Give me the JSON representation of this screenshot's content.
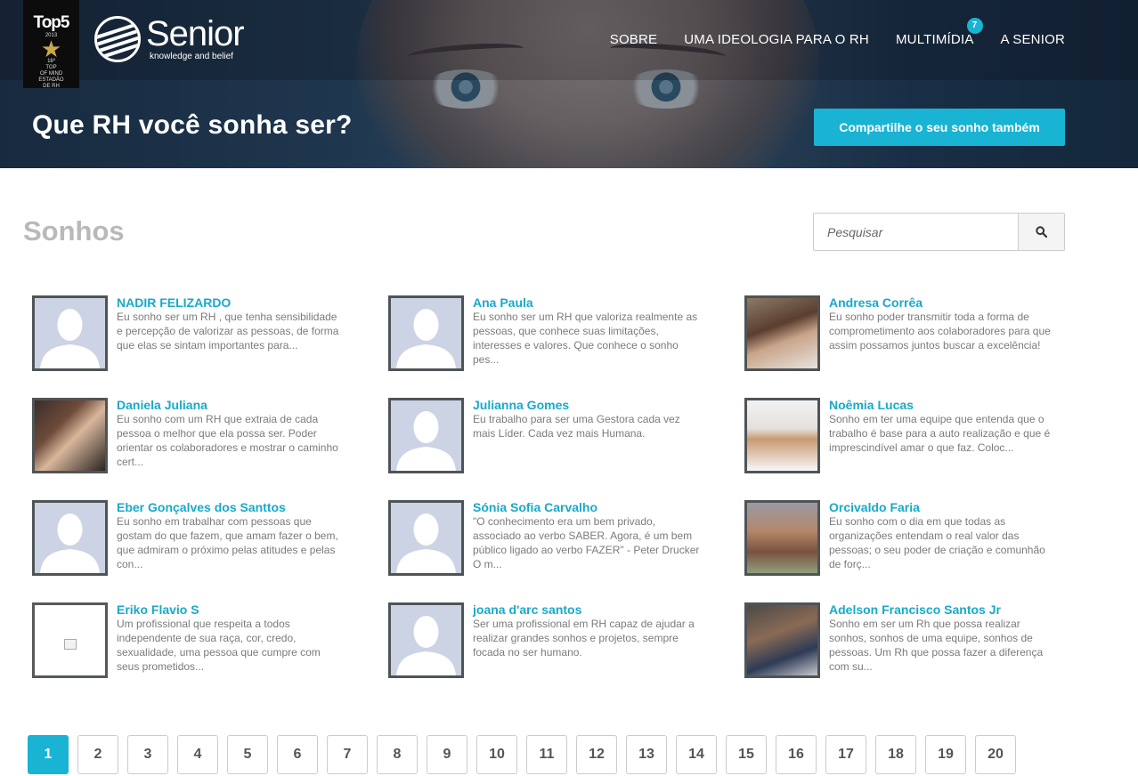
{
  "brand": {
    "award": {
      "title": "Top5",
      "year": "2013",
      "lines": [
        "16º",
        "TOP",
        "OF MIND",
        "ESTADÃO",
        "DE RH"
      ]
    },
    "name": "Senior",
    "tagline": "knowledge and belief"
  },
  "nav": {
    "items": [
      {
        "label": "SOBRE"
      },
      {
        "label": "UMA IDEOLOGIA PARA O RH"
      },
      {
        "label": "MULTIMÍDIA",
        "badge": "7"
      },
      {
        "label": "A SENIOR"
      }
    ]
  },
  "hero": {
    "title": "Que RH você sonha ser?",
    "cta": "Compartilhe o seu sonho também"
  },
  "section": {
    "title": "Sonhos",
    "search_placeholder": "Pesquisar"
  },
  "dreams": [
    {
      "name": "NADIR FELIZARDO",
      "text": "Eu sonho ser um RH , que tenha sensibilidade e percepção de valorizar as pessoas, de forma que elas se sintam importantes para...",
      "avatar": "placeholder"
    },
    {
      "name": "Ana Paula",
      "text": "Eu sonho ser um RH que valoriza realmente as pessoas, que conhece suas limitações, interesses e valores. Que conhece o sonho pes...",
      "avatar": "placeholder"
    },
    {
      "name": "Andresa Corrêa",
      "text": "Eu sonho poder transmitir toda a forma de comprometimento aos colaboradores para que assim possamos juntos buscar a excelência!",
      "avatar": "photo"
    },
    {
      "name": "Daniela Juliana",
      "text": "Eu sonho com um RH que extraia de cada pessoa o melhor que ela possa ser. Poder orientar os colaboradores e mostrar o caminho cert...",
      "avatar": "photo"
    },
    {
      "name": "Julianna Gomes",
      "text": "Eu trabalho para ser uma Gestora cada vez mais Líder. Cada vez mais Humana.",
      "avatar": "placeholder"
    },
    {
      "name": "Noêmia Lucas",
      "text": "Sonho em ter uma equipe que entenda que o trabalho é base para a auto realização e que é imprescindível amar o que faz. Coloc...",
      "avatar": "photo"
    },
    {
      "name": "Eber Gonçalves dos Santtos",
      "text": "Eu sonho em trabalhar com pessoas que gostam do que fazem, que amam fazer o bem, que admiram o próximo pelas atitudes e pelas con...",
      "avatar": "placeholder"
    },
    {
      "name": "Sónia Sofia Carvalho",
      "text": "\"O conhecimento era um bem privado, associado ao verbo SABER. Agora, é um bem público ligado ao verbo FAZER\" - Peter Drucker O m...",
      "avatar": "placeholder"
    },
    {
      "name": "Orcivaldo Faria",
      "text": "Eu sonho com o dia em que todas as organizações entendam o real valor das pessoas; o seu poder de criação e comunhão de forç...",
      "avatar": "photo"
    },
    {
      "name": "Eriko Flavio S",
      "text": "Um profissional que respeita a todos independente de sua raça, cor, credo, sexualidade, uma pessoa que cumpre com seus prometidos...",
      "avatar": "broken"
    },
    {
      "name": "joana d'arc santos",
      "text": "Ser uma profissional em RH capaz de ajudar a realizar grandes sonhos e projetos, sempre focada no ser humano.",
      "avatar": "placeholder"
    },
    {
      "name": "Adelson Francisco Santos Jr",
      "text": "Sonho em ser um Rh que possa realizar sonhos, sonhos de uma equipe, sonhos de pessoas. Um Rh que possa fazer a diferença com su...",
      "avatar": "photo"
    }
  ],
  "pagination": {
    "current": "1",
    "pages": [
      "1",
      "2",
      "3",
      "4",
      "5",
      "6",
      "7",
      "8",
      "9",
      "10",
      "11",
      "12",
      "13",
      "14",
      "15",
      "16",
      "17",
      "18",
      "19",
      "20"
    ]
  },
  "colors": {
    "accent": "#19b3d3",
    "name": "#19a9c9",
    "heading_grey": "#b9b9b9"
  }
}
